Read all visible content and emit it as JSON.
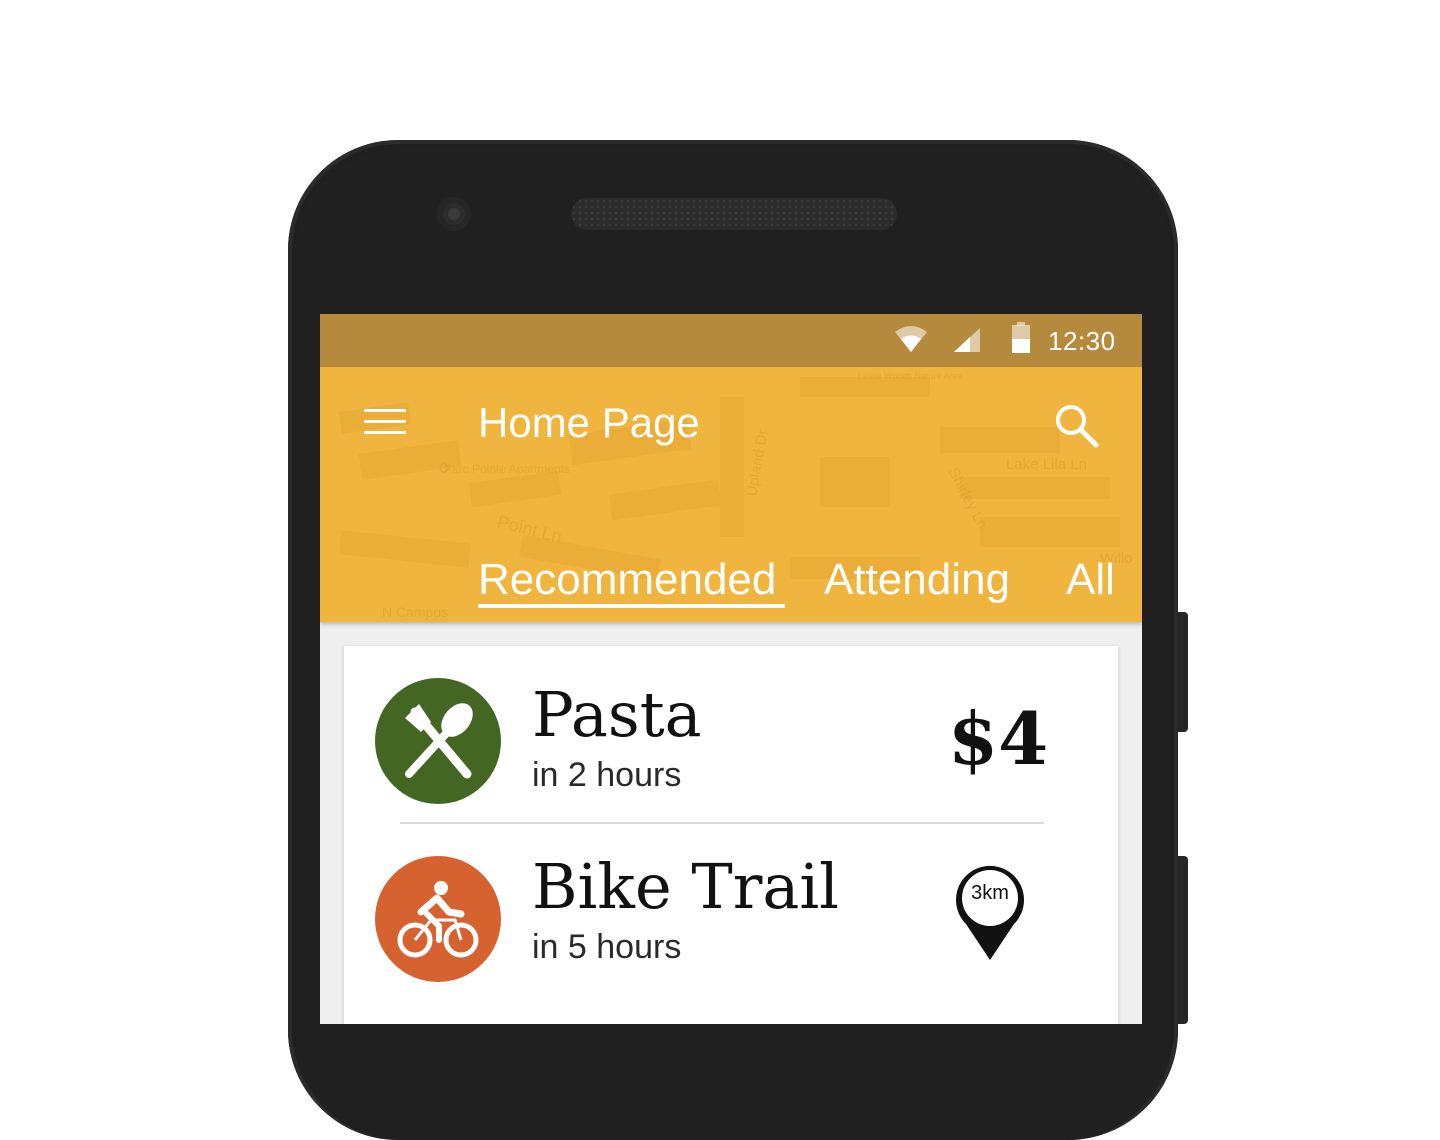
{
  "status_bar": {
    "time": "12:30",
    "icons": [
      "wifi-icon",
      "signal-icon",
      "battery-icon"
    ],
    "color": "#b58a3d"
  },
  "app_bar": {
    "title": "Home Page",
    "color": "#f0b53e",
    "menu_icon": "menu-icon",
    "search_icon": "search-icon",
    "map_labels": [
      "Parc Pointe Apartments",
      "Upland Dr",
      "Point Ln",
      "Shirley Ln",
      "Lake Lila Ln",
      "N Campus",
      "Leslie Woods Nature Area",
      "Willo"
    ]
  },
  "tabs": [
    {
      "label": "Recommended",
      "selected": true
    },
    {
      "label": "Attending",
      "selected": false
    },
    {
      "label": "All",
      "selected": false
    }
  ],
  "events": [
    {
      "title": "Pasta",
      "subtitle": "in 2 hours",
      "icon": "fork-spoon-icon",
      "icon_color": "#436623",
      "right_type": "price",
      "right_value": "$4"
    },
    {
      "title": "Bike Trail",
      "subtitle": "in 5 hours",
      "icon": "bicycle-icon",
      "icon_color": "#d6632f",
      "right_type": "distance",
      "right_value": "3km"
    }
  ]
}
